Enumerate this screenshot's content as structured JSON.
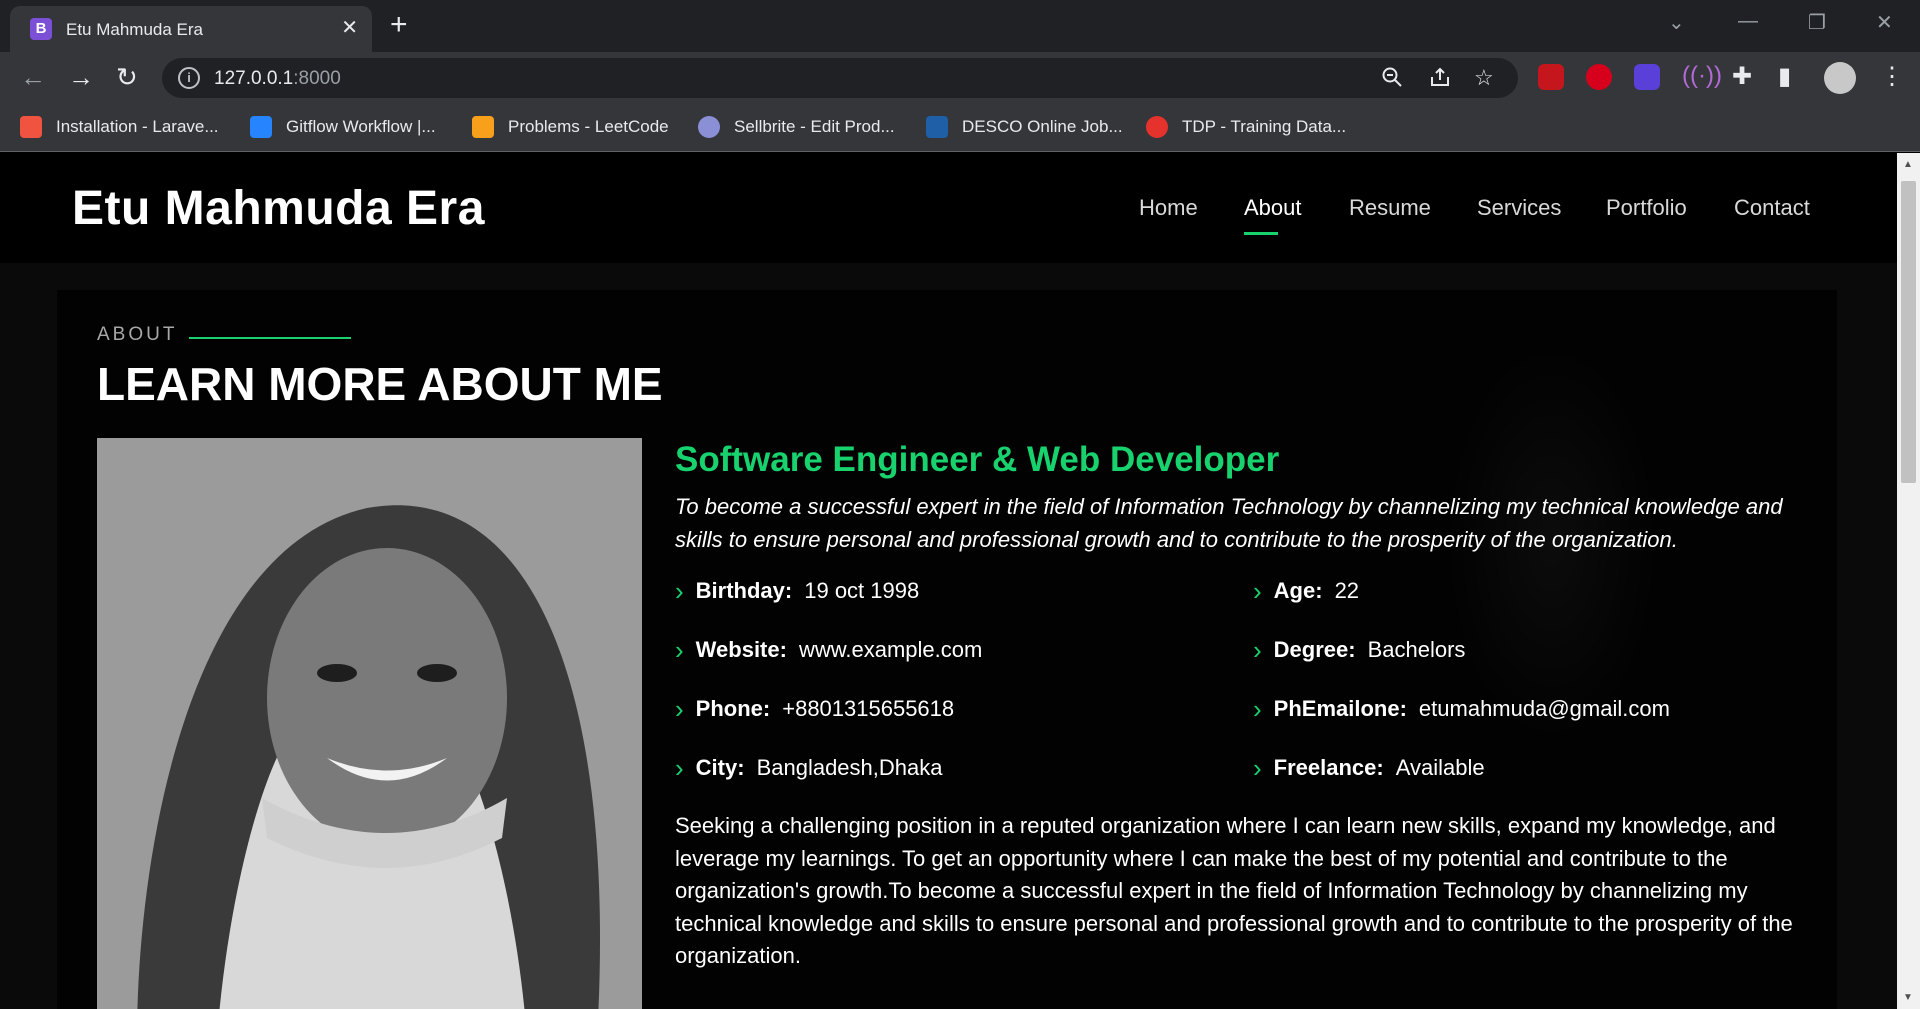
{
  "browser": {
    "tab_title": "Etu Mahmuda Era",
    "tab_favicon": "B",
    "url_host": "127.0.0.1",
    "url_port": ":8000",
    "bookmarks": [
      {
        "label": "Installation - Larave...",
        "icon": "laravel-icon",
        "color": "#f05340"
      },
      {
        "label": "Gitflow Workflow |...",
        "icon": "atlassian-icon",
        "color": "#2684ff"
      },
      {
        "label": "Problems - LeetCode",
        "icon": "leetcode-icon",
        "color": "#f89f1b"
      },
      {
        "label": "Sellbrite - Edit Prod...",
        "icon": "sellbrite-icon",
        "color": "#8a8fd6"
      },
      {
        "label": "DESCO Online Job...",
        "icon": "desco-icon",
        "color": "#1f5fa8"
      },
      {
        "label": "TDP - Training Data...",
        "icon": "tdp-icon",
        "color": "#e5322d"
      }
    ]
  },
  "site": {
    "logo": "Etu Mahmuda Era",
    "nav": [
      "Home",
      "About",
      "Resume",
      "Services",
      "Portfolio",
      "Contact"
    ],
    "active_nav": "About"
  },
  "about": {
    "eyebrow": "ABOUT",
    "heading": "LEARN MORE ABOUT ME",
    "role": "Software Engineer & Web Developer",
    "intro": "To become a successful expert in the field of Information Technology by channelizing my technical knowledge and skills to ensure personal and professional growth and to contribute to the prosperity of the organization.",
    "facts_left": [
      {
        "label": "Birthday:",
        "value": "19 oct 1998"
      },
      {
        "label": "Website:",
        "value": "www.example.com"
      },
      {
        "label": "Phone:",
        "value": "+8801315655618"
      },
      {
        "label": "City:",
        "value": "Bangladesh,Dhaka"
      }
    ],
    "facts_right": [
      {
        "label": "Age:",
        "value": "22"
      },
      {
        "label": "Degree:",
        "value": "Bachelors"
      },
      {
        "label": "PhEmailone:",
        "value": "etumahmuda@gmail.com"
      },
      {
        "label": "Freelance:",
        "value": "Available"
      }
    ],
    "summary": "Seeking a challenging position in a reputed organization where I can learn new skills, expand my knowledge, and leverage my learnings. To get an opportunity where I can make the best of my potential and contribute to the organization's growth.To become a successful expert in the field of Information Technology by channelizing my technical knowledge and skills to ensure personal and professional growth and to contribute to the prosperity of the organization."
  },
  "colors": {
    "accent": "#18d26e",
    "background": "#000000"
  }
}
